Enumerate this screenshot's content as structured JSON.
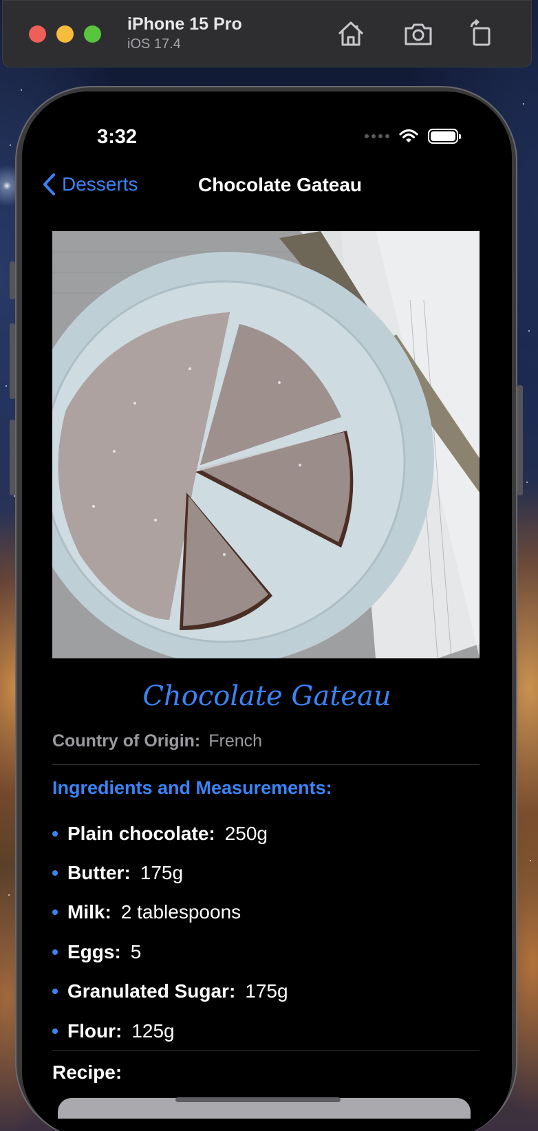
{
  "simulator": {
    "device_name": "iPhone 15 Pro",
    "os_version": "iOS 17.4",
    "tools": [
      "home-icon",
      "screenshot-camera-icon",
      "rotate-icon"
    ]
  },
  "status_bar": {
    "time": "3:32"
  },
  "nav": {
    "back_label": "Desserts",
    "title": "Chocolate Gateau"
  },
  "meal": {
    "image_alt": "Chocolate gateau dusted with powdered sugar on a plate",
    "name": "Chocolate Gateau",
    "origin_label": "Country of Origin:",
    "origin_value": "French",
    "ingredients_heading": "Ingredients and Measurements:",
    "ingredients": [
      {
        "name": "Plain chocolate:",
        "measure": "250g"
      },
      {
        "name": "Butter:",
        "measure": "175g"
      },
      {
        "name": "Milk:",
        "measure": "2 tablespoons"
      },
      {
        "name": "Eggs:",
        "measure": "5"
      },
      {
        "name": "Granulated Sugar:",
        "measure": "175g"
      },
      {
        "name": "Flour:",
        "measure": "125g"
      }
    ],
    "recipe_heading": "Recipe:"
  },
  "colors": {
    "accent": "#3a84f7",
    "background": "#000000",
    "secondary_text": "#9a9aa0"
  }
}
